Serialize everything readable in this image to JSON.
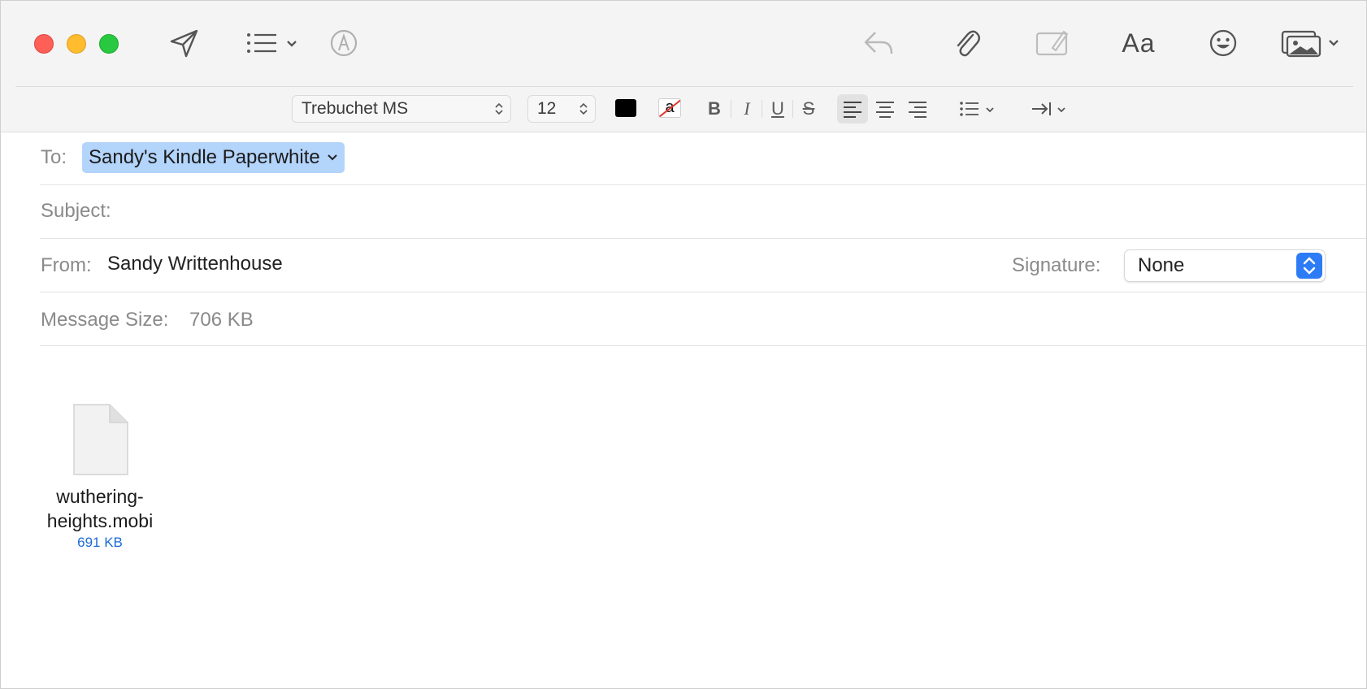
{
  "toolbar": {
    "font_family": "Trebuchet MS",
    "font_size": "12",
    "text_color": "#000000",
    "bold_label": "B",
    "italic_label": "I",
    "underline_label": "U",
    "strike_label": "S",
    "aa_label": "Aa",
    "bg_color_glyph": "a"
  },
  "header": {
    "to_label": "To:",
    "recipient": "Sandy's Kindle Paperwhite",
    "subject_label": "Subject:",
    "subject_value": "",
    "from_label": "From:",
    "from_value": "Sandy Writtenhouse",
    "signature_label": "Signature:",
    "signature_value": "None",
    "message_size_label": "Message Size:",
    "message_size_value": "706 KB"
  },
  "attachment": {
    "name_line1": "wuthering-",
    "name_line2": "heights.mobi",
    "size": "691 KB"
  },
  "colors": {
    "close": "#fe5f57",
    "minimize": "#febc2e",
    "zoom": "#28c840",
    "recipient_highlight": "#b3d4fb",
    "accent": "#2d7cf6",
    "size_link": "#1c6bd6"
  }
}
